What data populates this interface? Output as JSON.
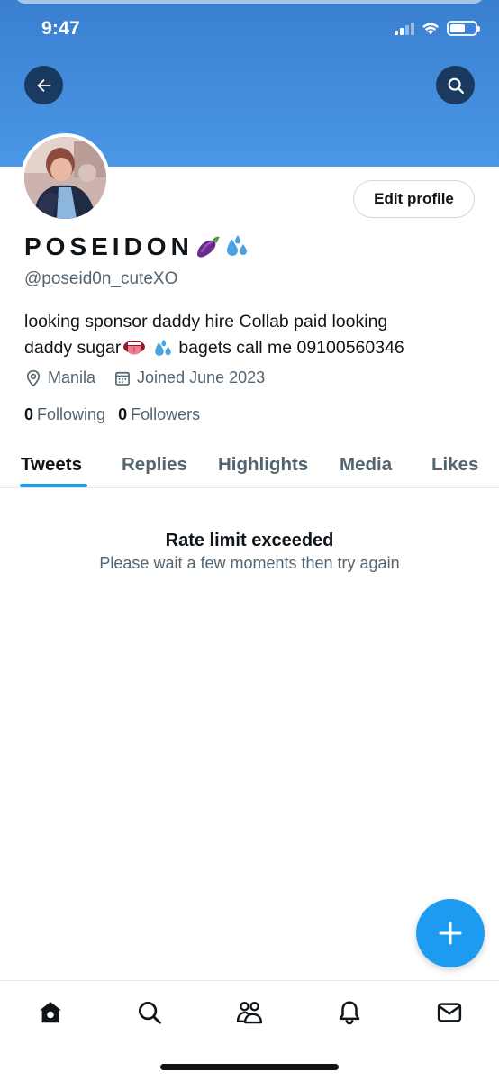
{
  "status_bar": {
    "time": "9:47"
  },
  "profile": {
    "display_name": "POSEIDON",
    "name_emojis": [
      "eggplant-emoji",
      "sweat-droplets-emoji"
    ],
    "handle": "@poseid0n_cuteXO",
    "bio_line1": "looking sponsor daddy hire Collab paid looking",
    "bio_line2_before": "daddy sugar",
    "bio_line2_after": "bagets call me 09100560346",
    "bio_emojis": [
      "tongue-emoji",
      "sweat-droplets-emoji"
    ],
    "location": "Manila",
    "joined": "Joined June 2023",
    "following_count": "0",
    "following_label": "Following",
    "followers_count": "0",
    "followers_label": "Followers",
    "edit_label": "Edit profile"
  },
  "tabs": [
    {
      "label": "Tweets",
      "active": true
    },
    {
      "label": "Replies",
      "active": false
    },
    {
      "label": "Highlights",
      "active": false
    },
    {
      "label": "Media",
      "active": false
    },
    {
      "label": "Likes",
      "active": false
    }
  ],
  "empty_state": {
    "title": "Rate limit exceeded",
    "subtitle": "Please wait a few moments then try again"
  },
  "colors": {
    "banner": "#4a97e6",
    "accent": "#1d9bf0",
    "text_primary": "#0f1419",
    "text_secondary": "#536471"
  },
  "bottom_nav": [
    {
      "icon": "home-icon",
      "active": true
    },
    {
      "icon": "search-icon",
      "active": false
    },
    {
      "icon": "communities-icon",
      "active": false
    },
    {
      "icon": "bell-icon",
      "active": false
    },
    {
      "icon": "mail-icon",
      "active": false
    }
  ],
  "fab": {
    "icon": "plus-icon"
  },
  "battery_level": 0.6
}
